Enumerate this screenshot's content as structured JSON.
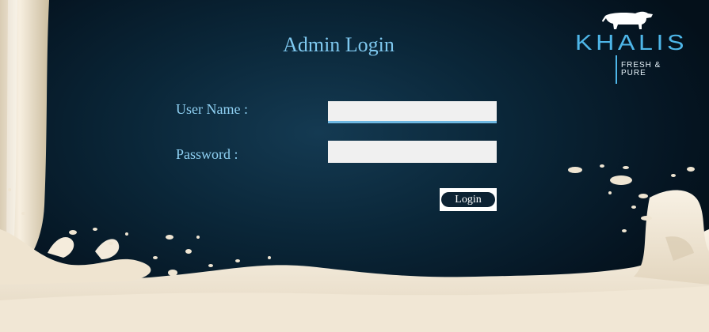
{
  "page": {
    "title": "Admin Login"
  },
  "brand": {
    "name": "KHALIS",
    "tagline_line1": "FRESH &",
    "tagline_line2": "PURE"
  },
  "form": {
    "username_label": "User Name :",
    "username_value": "",
    "password_label": "Password :",
    "password_value": "",
    "login_label": "Login"
  },
  "colors": {
    "background": "#0a2638",
    "accent": "#7ec8ef",
    "milk": "#f2e8d6"
  }
}
